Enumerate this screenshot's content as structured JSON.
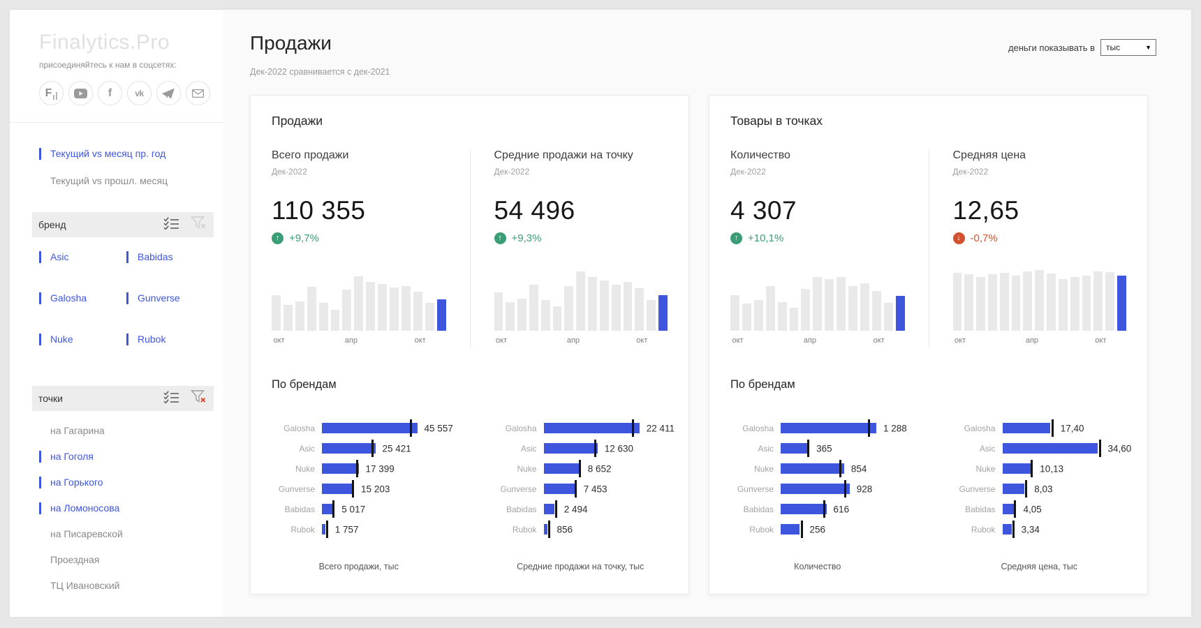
{
  "app": {
    "logo": "Finalytics.Pro",
    "social_caption": "присоединяйтесь к нам в соцсетях:",
    "social_icons": [
      "finalytics-icon",
      "youtube-icon",
      "facebook-icon",
      "vk-icon",
      "telegram-icon",
      "email-icon"
    ]
  },
  "sidebar": {
    "period_options": [
      {
        "label": "Текущий vs месяц пр. год",
        "selected": true
      },
      {
        "label": "Текущий vs прошл. месяц",
        "selected": false
      }
    ],
    "brand_filter": {
      "title": "бренд",
      "items": [
        {
          "label": "Asic",
          "selected": true
        },
        {
          "label": "Babidas",
          "selected": true
        },
        {
          "label": "Galosha",
          "selected": true
        },
        {
          "label": "Gunverse",
          "selected": true
        },
        {
          "label": "Nuke",
          "selected": true
        },
        {
          "label": "Rubok",
          "selected": true
        }
      ]
    },
    "points_filter": {
      "title": "точки",
      "items": [
        {
          "label": "на Гагарина",
          "selected": false
        },
        {
          "label": "на Гоголя",
          "selected": true
        },
        {
          "label": "на Горького",
          "selected": true
        },
        {
          "label": "на Ломоносова",
          "selected": true
        },
        {
          "label": "на Писаревской",
          "selected": false
        },
        {
          "label": "Проездная",
          "selected": false
        },
        {
          "label": "ТЦ Ивановский",
          "selected": false
        }
      ]
    }
  },
  "header": {
    "title": "Продажи",
    "subtitle": "Дек-2022 сравнивается с дек-2021",
    "money_label": "деньги показывать в",
    "money_unit": "тыс"
  },
  "colors": {
    "accent": "#3e55dd",
    "positive": "#3a9d76",
    "negative": "#d2512e",
    "bar_idle": "#e9e9e9",
    "tick": "#141414"
  },
  "cards": [
    {
      "title": "Продажи",
      "brands_title": "По брендам",
      "kpis": [
        {
          "label": "Всего продажи",
          "period": "Дек-2022",
          "value": "110 355",
          "delta": "+9,7%",
          "direction": "up",
          "sparkline": {
            "axis": [
              "окт",
              "апр",
              "окт"
            ],
            "values": [
              0.55,
              0.4,
              0.46,
              0.68,
              0.43,
              0.33,
              0.64,
              0.85,
              0.76,
              0.73,
              0.67,
              0.7,
              0.61,
              0.43,
              0.49
            ]
          }
        },
        {
          "label": "Средние продажи на точку",
          "period": "Дек-2022",
          "value": "54 496",
          "delta": "+9,3%",
          "direction": "up",
          "sparkline": {
            "axis": [
              "окт",
              "апр",
              "окт"
            ],
            "values": [
              0.6,
              0.45,
              0.5,
              0.72,
              0.48,
              0.38,
              0.7,
              0.92,
              0.84,
              0.78,
              0.72,
              0.76,
              0.66,
              0.48,
              0.55
            ]
          }
        }
      ],
      "bullets": [
        {
          "footer": "Всего продажи, тыс",
          "rows": [
            {
              "label": "Galosha",
              "display": "45 557",
              "frac": 0.91,
              "tick": 0.84
            },
            {
              "label": "Asic",
              "display": "25 421",
              "frac": 0.51,
              "tick": 0.475
            },
            {
              "label": "Nuke",
              "display": "17 399",
              "frac": 0.35,
              "tick": 0.325
            },
            {
              "label": "Gunverse",
              "display": "15 203",
              "frac": 0.305,
              "tick": 0.287
            },
            {
              "label": "Babidas",
              "display": "5 017",
              "frac": 0.1,
              "tick": 0.102
            },
            {
              "label": "Rubok",
              "display": "1 757",
              "frac": 0.035,
              "tick": 0.038
            }
          ]
        },
        {
          "footer": "Средние продажи на точку, тыс",
          "rows": [
            {
              "label": "Galosha",
              "display": "22 411",
              "frac": 0.915,
              "tick": 0.845
            },
            {
              "label": "Asic",
              "display": "12 630",
              "frac": 0.515,
              "tick": 0.48
            },
            {
              "label": "Nuke",
              "display": "8 652",
              "frac": 0.353,
              "tick": 0.335
            },
            {
              "label": "Gunverse",
              "display": "7 453",
              "frac": 0.304,
              "tick": 0.295
            },
            {
              "label": "Babidas",
              "display": "2 494",
              "frac": 0.102,
              "tick": 0.108
            },
            {
              "label": "Rubok",
              "display": "856",
              "frac": 0.035,
              "tick": 0.04
            }
          ]
        }
      ]
    },
    {
      "title": "Товары в точках",
      "brands_title": "По брендам",
      "kpis": [
        {
          "label": "Количество",
          "period": "Дек-2022",
          "value": "4 307",
          "delta": "+10,1%",
          "direction": "up",
          "sparkline": {
            "axis": [
              "окт",
              "апр",
              "окт"
            ],
            "values": [
              0.55,
              0.42,
              0.48,
              0.7,
              0.45,
              0.36,
              0.65,
              0.84,
              0.8,
              0.84,
              0.7,
              0.74,
              0.62,
              0.44,
              0.54
            ]
          }
        },
        {
          "label": "Средняя цена",
          "period": "Дек-2022",
          "value": "12,65",
          "delta": "-0,7%",
          "direction": "down",
          "sparkline": {
            "axis": [
              "окт",
              "апр",
              "окт"
            ],
            "values": [
              0.9,
              0.88,
              0.84,
              0.88,
              0.9,
              0.86,
              0.92,
              0.95,
              0.89,
              0.8,
              0.84,
              0.86,
              0.92,
              0.91,
              0.86
            ]
          }
        }
      ],
      "bullets": [
        {
          "footer": "Количество",
          "rows": [
            {
              "label": "Galosha",
              "display": "1 288",
              "frac": 0.913,
              "tick": 0.83
            },
            {
              "label": "Asic",
              "display": "365",
              "frac": 0.259,
              "tick": 0.254
            },
            {
              "label": "Nuke",
              "display": "854",
              "frac": 0.606,
              "tick": 0.56
            },
            {
              "label": "Gunverse",
              "display": "928",
              "frac": 0.658,
              "tick": 0.605
            },
            {
              "label": "Babidas",
              "display": "616",
              "frac": 0.437,
              "tick": 0.405
            },
            {
              "label": "Rubok",
              "display": "256",
              "frac": 0.182,
              "tick": 0.19
            }
          ]
        },
        {
          "footer": "Средняя цена, тыс",
          "rows": [
            {
              "label": "Galosha",
              "display": "17,40",
              "frac": 0.458,
              "tick": 0.468
            },
            {
              "label": "Asic",
              "display": "34,60",
              "frac": 0.911,
              "tick": 0.92
            },
            {
              "label": "Nuke",
              "display": "10,13",
              "frac": 0.267,
              "tick": 0.272
            },
            {
              "label": "Gunverse",
              "display": "8,03",
              "frac": 0.211,
              "tick": 0.218
            },
            {
              "label": "Babidas",
              "display": "4,05",
              "frac": 0.107,
              "tick": 0.113
            },
            {
              "label": "Rubok",
              "display": "3,34",
              "frac": 0.088,
              "tick": 0.094
            }
          ]
        }
      ]
    }
  ]
}
